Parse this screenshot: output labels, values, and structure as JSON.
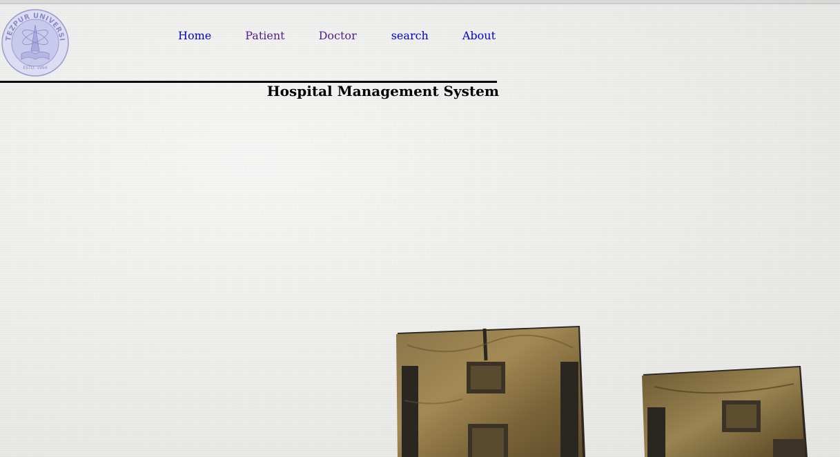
{
  "nav": {
    "items": [
      {
        "label": "Home",
        "state": "unvisited"
      },
      {
        "label": "Patient",
        "state": "visited"
      },
      {
        "label": "Doctor",
        "state": "visited"
      },
      {
        "label": "search",
        "state": "unvisited"
      },
      {
        "label": "About",
        "state": "unvisited"
      }
    ]
  },
  "page": {
    "title": "Hospital Management System"
  },
  "logo": {
    "icon": "tezpur-university-seal-icon",
    "text": "TEZPUR UNIVERSITY",
    "established": "ESTD. 1994"
  },
  "hero": {
    "icon": "wooden-letterpress-blocks-image"
  },
  "colors": {
    "link": "#0000cc",
    "visited_link": "#551a8b",
    "title": "#000000",
    "rule": "#000000",
    "background": "#ededeb"
  }
}
